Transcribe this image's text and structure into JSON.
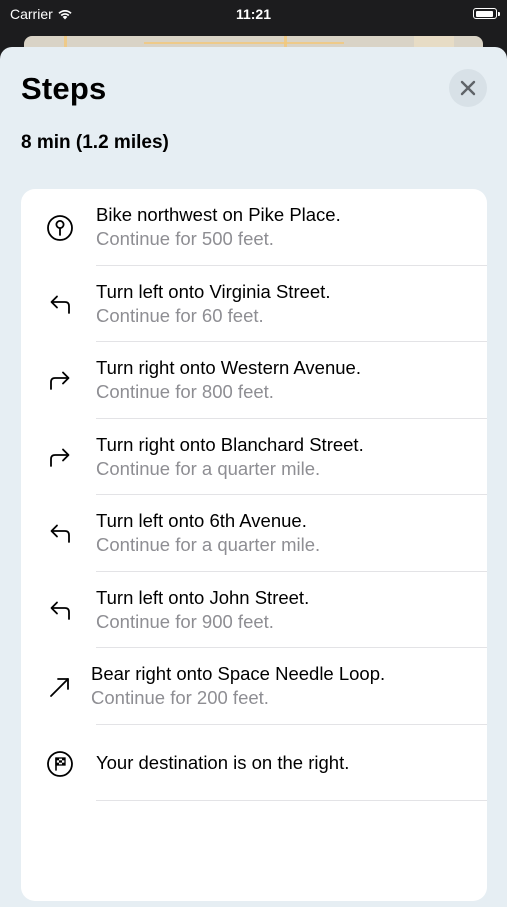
{
  "status_bar": {
    "carrier": "Carrier",
    "time": "11:21",
    "battery_level": 0.92
  },
  "sheet": {
    "title": "Steps",
    "summary": "8 min (1.2 miles)",
    "close_icon": "xmark-icon"
  },
  "colors": {
    "sheet_background": "#e6eef3",
    "card_background": "#ffffff",
    "secondary_text": "#8e8e93",
    "close_button_background": "#d8e1e7"
  },
  "steps": [
    {
      "icon": "start-pin-icon",
      "instruction": "Bike northwest on Pike Place.",
      "detail": "Continue for 500 feet."
    },
    {
      "icon": "turn-left-icon",
      "instruction": "Turn left onto Virginia Street.",
      "detail": "Continue for 60 feet."
    },
    {
      "icon": "turn-right-icon",
      "instruction": "Turn right onto Western Avenue.",
      "detail": "Continue for 800 feet."
    },
    {
      "icon": "turn-right-icon",
      "instruction": "Turn right onto Blanchard Street.",
      "detail": "Continue for a quarter mile."
    },
    {
      "icon": "turn-left-icon",
      "instruction": "Turn left onto 6th Avenue.",
      "detail": "Continue for a quarter mile."
    },
    {
      "icon": "turn-left-icon",
      "instruction": "Turn left onto John Street.",
      "detail": "Continue for 900 feet."
    },
    {
      "icon": "bear-right-icon",
      "instruction": "Bear right onto Space Needle Loop.",
      "detail": "Continue for 200 feet."
    },
    {
      "icon": "destination-flag-icon",
      "instruction": "Your destination is on the right.",
      "detail": ""
    }
  ]
}
